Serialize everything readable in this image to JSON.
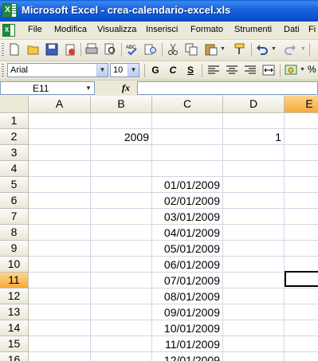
{
  "window": {
    "title": "Microsoft Excel - crea-calendario-excel.xls"
  },
  "menu": [
    "File",
    "Modifica",
    "Visualizza",
    "Inserisci",
    "Formato",
    "Strumenti",
    "Dati",
    "Fi"
  ],
  "toolbar_icons": [
    "new-icon",
    "open-icon",
    "save-icon",
    "permission-icon",
    "print-icon",
    "print-preview-icon",
    "spelling-icon",
    "research-icon",
    "cut-icon",
    "copy-icon",
    "paste-icon",
    "format-painter-icon",
    "undo-icon",
    "redo-icon"
  ],
  "format": {
    "font": "Arial",
    "size": "10",
    "bold": "G",
    "italic": "C",
    "underline": "S",
    "align_icons": [
      "align-left-icon",
      "align-center-icon",
      "align-right-icon",
      "merge-center-icon",
      "currency-icon"
    ]
  },
  "formula_bar": {
    "name_box": "E11",
    "fx": "fx",
    "value": ""
  },
  "sheet": {
    "columns": [
      "A",
      "B",
      "C",
      "D",
      "E"
    ],
    "active_column": "E",
    "rows": [
      "1",
      "2",
      "3",
      "4",
      "5",
      "6",
      "7",
      "8",
      "9",
      "10",
      "11",
      "12",
      "13",
      "14",
      "15",
      "16"
    ],
    "active_row": "11",
    "cells": {
      "B2": "2009",
      "D2": "1",
      "C5": "01/01/2009",
      "C6": "02/01/2009",
      "C7": "03/01/2009",
      "C8": "04/01/2009",
      "C9": "05/01/2009",
      "C10": "06/01/2009",
      "C11": "07/01/2009",
      "C12": "08/01/2009",
      "C13": "09/01/2009",
      "C14": "10/01/2009",
      "C15": "11/01/2009",
      "C16": "12/01/2009"
    },
    "selected_cell": "E11"
  },
  "colors": {
    "title_bar": "#0a5fd8",
    "active_header": "#f7a93c",
    "grid_line": "#d0d7e5"
  }
}
